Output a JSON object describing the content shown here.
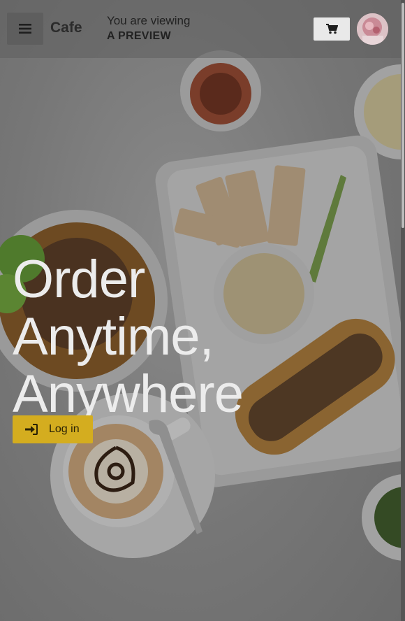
{
  "header": {
    "brand": "Cafe",
    "preview_line1": "You are viewing",
    "preview_line2": "A PREVIEW",
    "menu_icon": "hamburger-icon",
    "cart_icon": "cart-icon"
  },
  "hero": {
    "headline": [
      "Order",
      "Anytime,",
      "Anywhere"
    ],
    "login_label": "Log in",
    "login_icon": "sign-in-icon"
  },
  "colors": {
    "accent": "#d4ad1f",
    "overlay": "#5f5f5f"
  }
}
